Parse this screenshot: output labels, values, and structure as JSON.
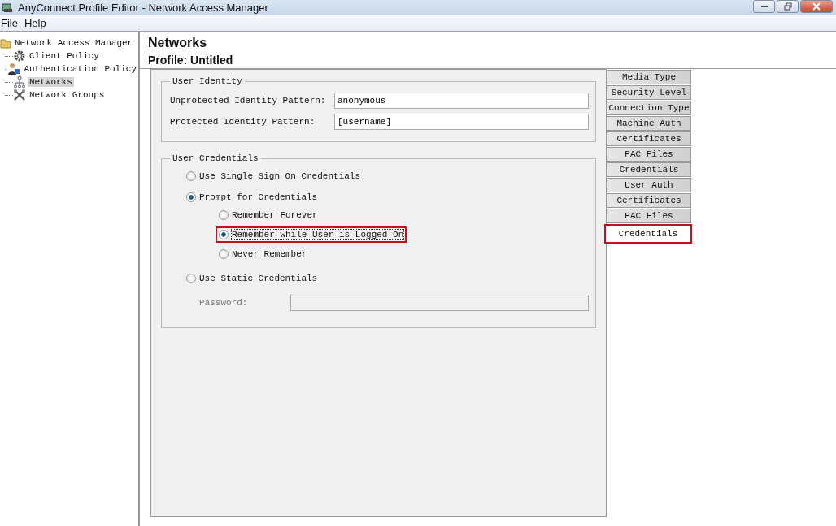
{
  "window": {
    "title": "AnyConnect Profile Editor - Network Access Manager"
  },
  "menu": [
    "File",
    "Help"
  ],
  "tree": {
    "label": "Network Access Manager",
    "children": [
      {
        "label": "Client Policy",
        "selected": false
      },
      {
        "label": "Authentication Policy",
        "selected": false
      },
      {
        "label": "Networks",
        "selected": true
      },
      {
        "label": "Network Groups",
        "selected": false
      }
    ]
  },
  "header": {
    "title": "Networks",
    "profile": "Profile:  Untitled"
  },
  "user_identity": {
    "legend": "User Identity",
    "fields": [
      {
        "label": "Unprotected Identity Pattern:",
        "value": "anonymous"
      },
      {
        "label": "Protected Identity Pattern:",
        "value": "[username]"
      }
    ]
  },
  "user_credentials": {
    "legend": "User Credentials",
    "options": [
      {
        "label": "Use Single Sign On Credentials",
        "selected": false
      },
      {
        "label": "Prompt for Credentials",
        "selected": true,
        "children": [
          {
            "label": "Remember Forever",
            "selected": false,
            "highlighted": false
          },
          {
            "label": "Remember while User is Logged On",
            "selected": true,
            "highlighted": true
          },
          {
            "label": "Never Remember",
            "selected": false,
            "highlighted": false
          }
        ]
      },
      {
        "label": "Use Static Credentials",
        "selected": false
      }
    ],
    "password": {
      "label": "Password:",
      "disabled": true
    }
  },
  "tabs": [
    {
      "label": "Media Type",
      "selected": false,
      "highlighted": false
    },
    {
      "label": "Security Level",
      "selected": false,
      "highlighted": false
    },
    {
      "label": "Connection Type",
      "selected": false,
      "highlighted": false
    },
    {
      "label": "Machine Auth",
      "selected": false,
      "highlighted": false
    },
    {
      "label": "Certificates",
      "selected": false,
      "highlighted": false
    },
    {
      "label": "PAC Files",
      "selected": false,
      "highlighted": false
    },
    {
      "label": "Credentials",
      "selected": false,
      "highlighted": false
    },
    {
      "label": "User Auth",
      "selected": false,
      "highlighted": false
    },
    {
      "label": "Certificates",
      "selected": false,
      "highlighted": false
    },
    {
      "label": "PAC Files",
      "selected": false,
      "highlighted": false
    },
    {
      "label": "Credentials",
      "selected": true,
      "highlighted": true
    }
  ]
}
